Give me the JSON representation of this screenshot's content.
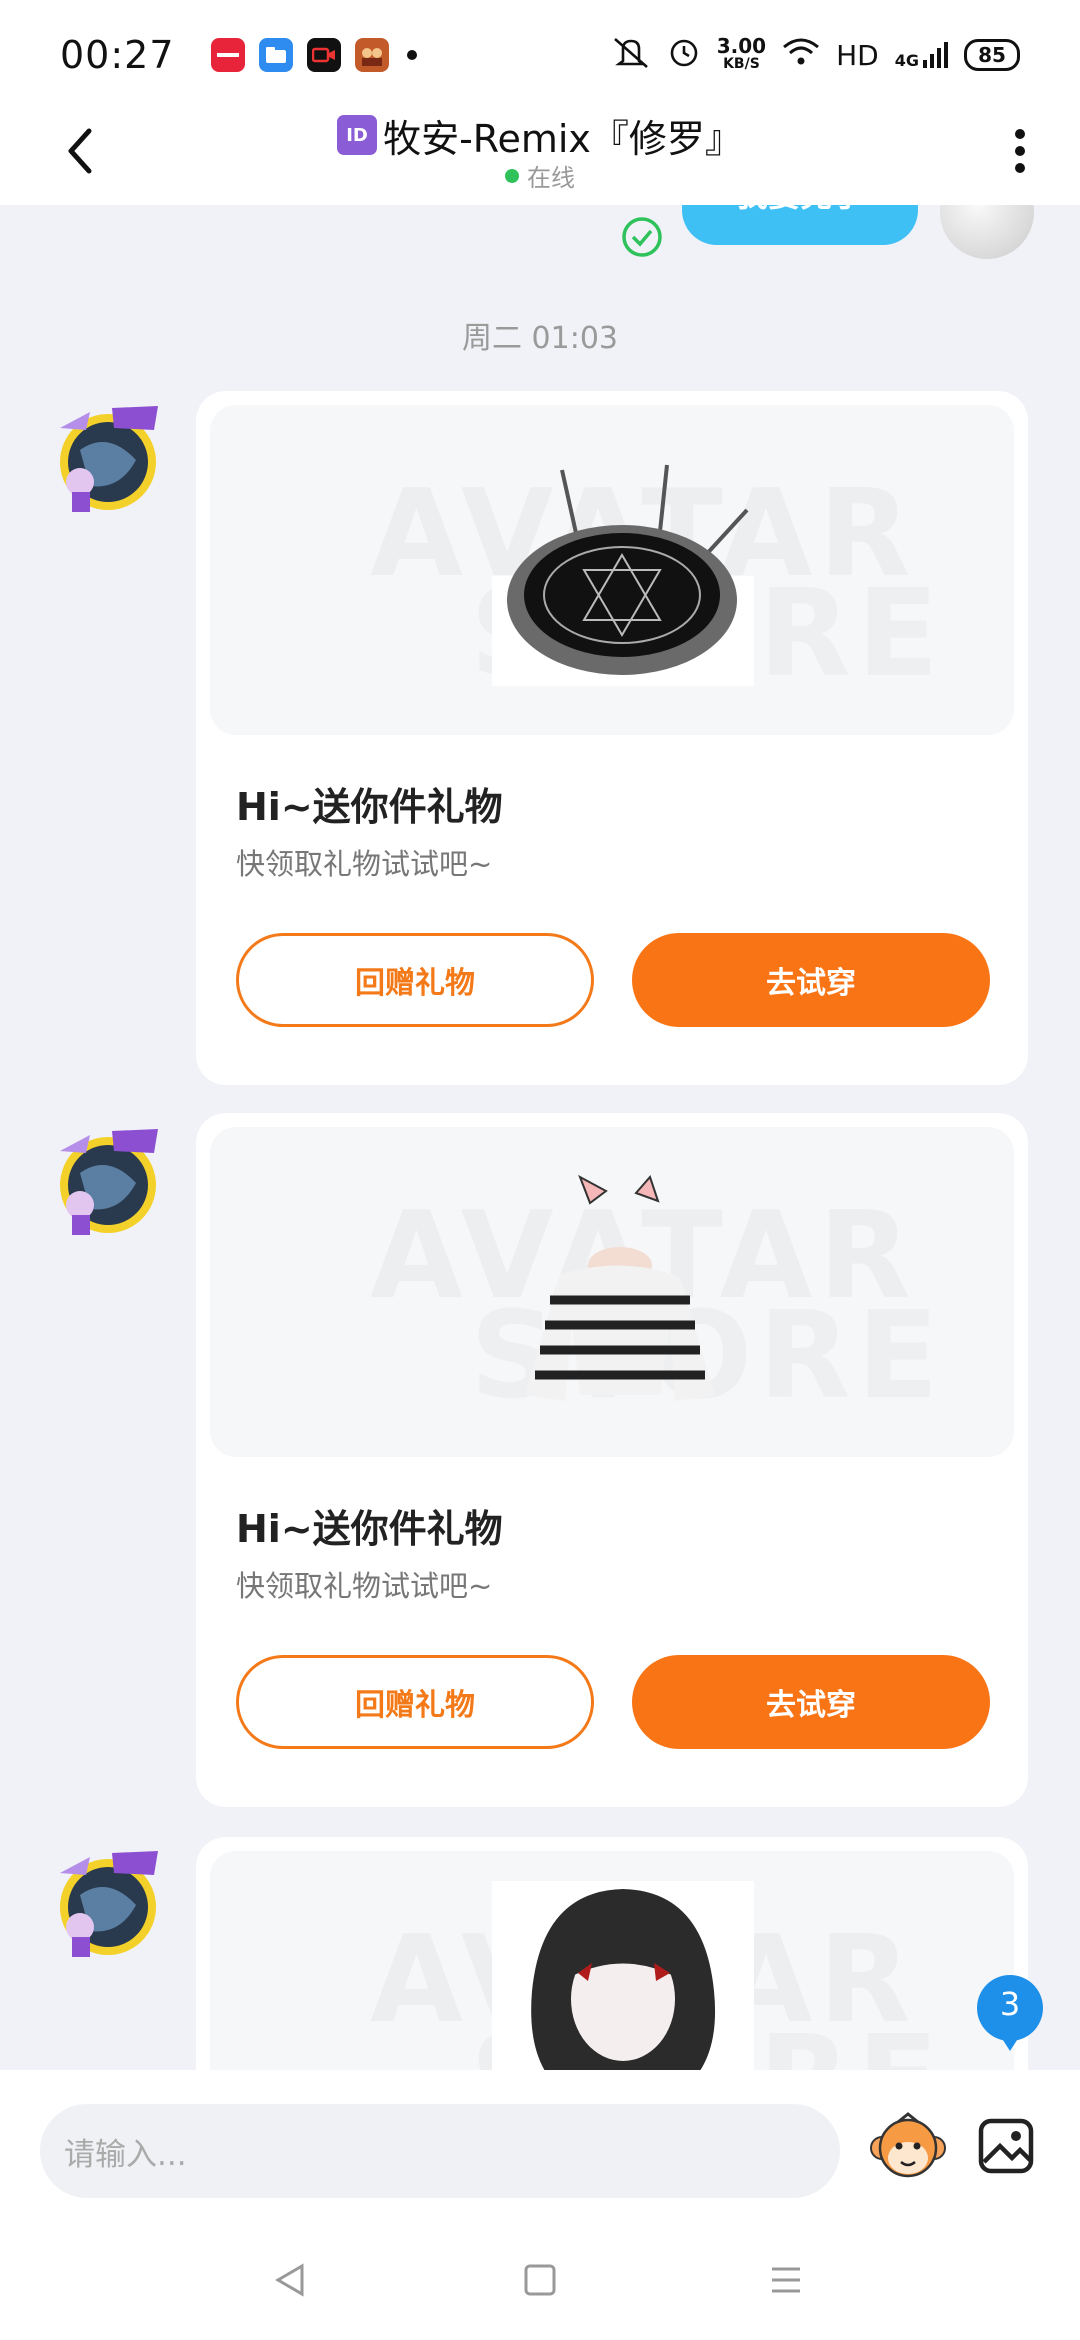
{
  "status_bar": {
    "time": "00:27",
    "speed_value": "3.00",
    "speed_unit": "KB/S",
    "network": "HD",
    "signal": "4G",
    "battery": "85",
    "apps": [
      "xiaohongshu-icon",
      "files-icon",
      "video-icon",
      "game-icon"
    ]
  },
  "header": {
    "id_badge": "ID",
    "title": "牧安-Remix『修罗』",
    "status": "在线"
  },
  "chat": {
    "peek_bubble_text": "我要兑了",
    "timestamp": "周二 01:03",
    "watermark_line1": "AVATAR",
    "watermark_line2": "STORE",
    "messages": [
      {
        "title": "Hi~送你件礼物",
        "subtitle": "快领取礼物试试吧~",
        "btn_return": "回赠礼物",
        "btn_try": "去试穿",
        "item": "magic-circle"
      },
      {
        "title": "Hi~送你件礼物",
        "subtitle": "快领取礼物试试吧~",
        "btn_return": "回赠礼物",
        "btn_try": "去试穿",
        "item": "striped-sweater"
      },
      {
        "item": "black-hair"
      }
    ],
    "unread_count": "3"
  },
  "input": {
    "placeholder": "请输入..."
  },
  "colors": {
    "accent_orange": "#f97415",
    "bubble_blue": "#3ec0f5",
    "online_green": "#2fc25b"
  }
}
